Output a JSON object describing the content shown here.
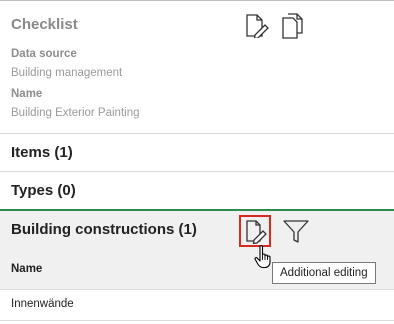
{
  "checklist": {
    "title": "Checklist",
    "data_source_label": "Data source",
    "data_source_value": "Building management",
    "name_label": "Name",
    "name_value": "Building Exterior Painting"
  },
  "sections": {
    "items_title": "Items (1)",
    "types_title": "Types (0)",
    "building_constructions_title": "Building constructions (1)"
  },
  "table": {
    "column_name": "Name",
    "rows": [
      {
        "name": "Innenwände"
      }
    ]
  },
  "tooltip": {
    "text": "Additional editing"
  },
  "icons": {
    "edit": "edit-document-icon",
    "copy": "copy-document-icon",
    "filter": "filter-icon",
    "cursor": "hand-pointer-icon"
  },
  "colors": {
    "section_divider": "#2f8a4f",
    "active_highlight": "#d6291f",
    "header_background": "#f0f0f0"
  }
}
